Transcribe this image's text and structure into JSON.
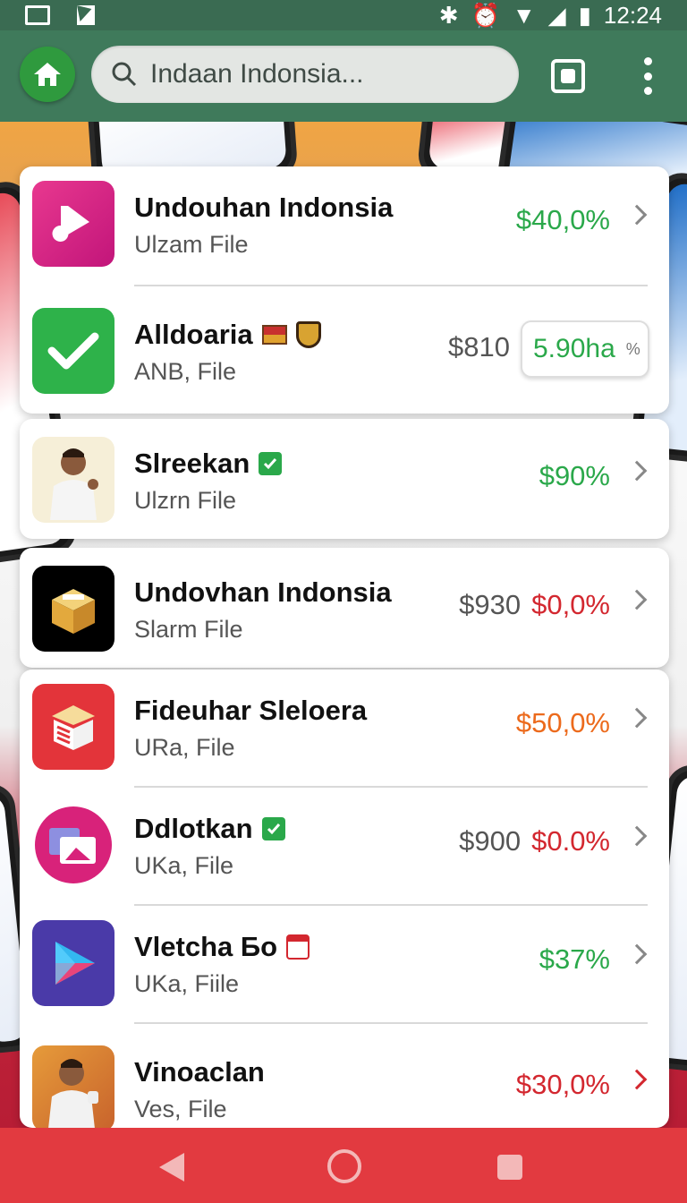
{
  "status_bar": {
    "time": "12:24"
  },
  "search": {
    "query": "Indaan Indonsia..."
  },
  "items": [
    {
      "name": "Undouhan Indonsia",
      "sub": "Ulzam File",
      "price": "",
      "value": "$40,0%",
      "color": "#2aa84a"
    },
    {
      "name": "Alldoaria",
      "sub": "ANB, File",
      "price": "$810",
      "value": "5.90ha",
      "pill_suffix": "%",
      "color": "#2aa84a"
    },
    {
      "name": "Slreekan",
      "sub": "Ulzrn File",
      "price": "",
      "value": "$90%",
      "color": "#2aa84a"
    },
    {
      "name": "Undovhan Indonsia",
      "sub": "Slarm File",
      "price": "$930",
      "value": "$0,0%",
      "color": "#d3272f"
    },
    {
      "name": "Fideuhar Sleloera",
      "sub": "URa, File",
      "price": "",
      "value": "$50,0%",
      "color": "#ec6a1c"
    },
    {
      "name": "Ddlotkan",
      "sub": "UKa, File",
      "price": "$900",
      "value": "$0.0%",
      "color": "#d3272f"
    },
    {
      "name": "Vletcha Бo",
      "sub": "UKa, Fiile",
      "price": "",
      "value": "$37%",
      "color": "#2aa84a"
    },
    {
      "name": "Vinoaclan",
      "sub": "Ves, File",
      "price": "",
      "value": "$30,0%",
      "color": "#d3272f"
    }
  ]
}
